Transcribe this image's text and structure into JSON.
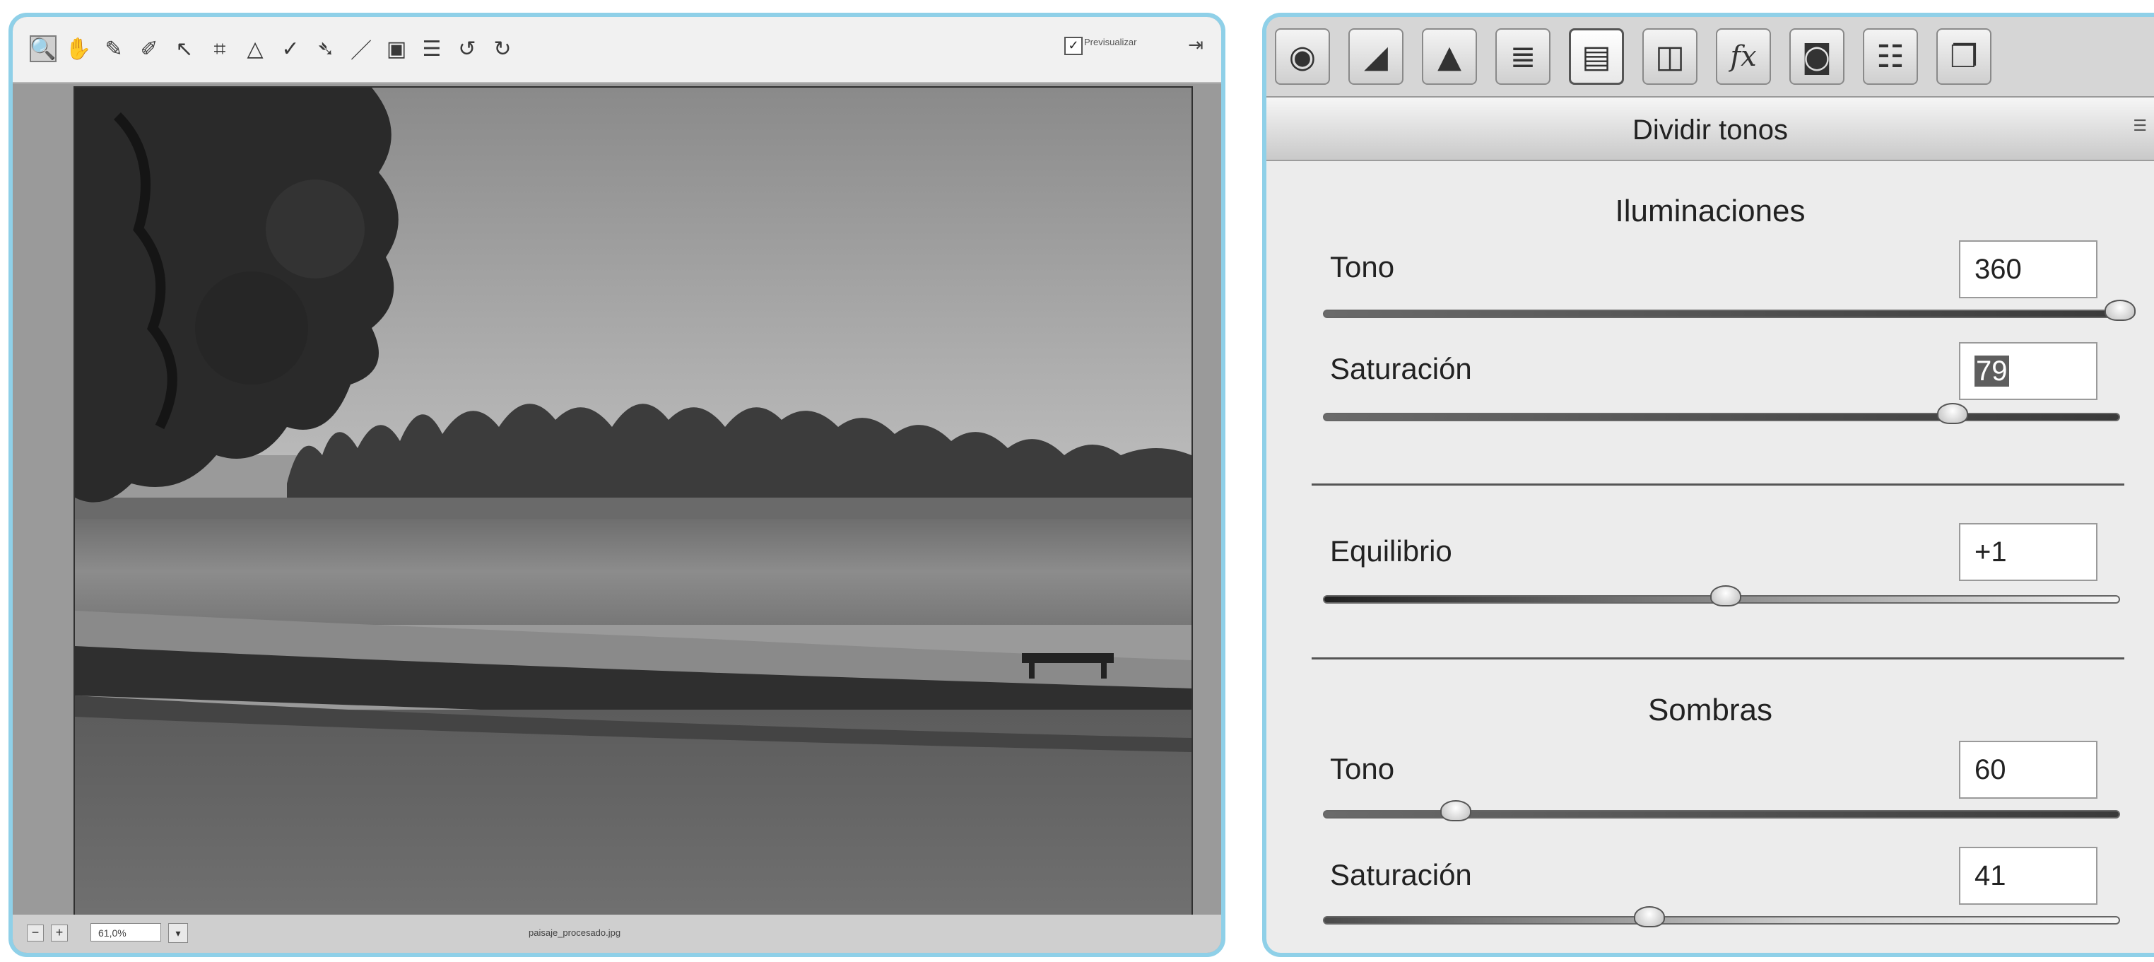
{
  "left_window": {
    "toolbar": {
      "tools": [
        {
          "name": "zoom-tool-icon",
          "glyph": "🔍"
        },
        {
          "name": "hand-tool-icon",
          "glyph": "✋"
        },
        {
          "name": "white-balance-tool-icon",
          "glyph": "✎"
        },
        {
          "name": "color-sampler-tool-icon",
          "glyph": "✐"
        },
        {
          "name": "targeted-adjustment-tool-icon",
          "glyph": "↖"
        },
        {
          "name": "crop-tool-icon",
          "glyph": "⌗"
        },
        {
          "name": "straighten-tool-icon",
          "glyph": "△"
        },
        {
          "name": "spot-removal-tool-icon",
          "glyph": "✓"
        },
        {
          "name": "red-eye-tool-icon",
          "glyph": "➴"
        },
        {
          "name": "adjustment-brush-icon",
          "glyph": "／"
        },
        {
          "name": "graduated-filter-icon",
          "glyph": "▣"
        },
        {
          "name": "preferences-icon",
          "glyph": "☰"
        },
        {
          "name": "rotate-left-icon",
          "glyph": "↺"
        },
        {
          "name": "rotate-right-icon",
          "glyph": "↻"
        }
      ],
      "preview_checked": "✓",
      "preview_label": "Previsualizar",
      "fullscreen_glyph": "⇥"
    },
    "statusbar": {
      "zoom_minus": "−",
      "zoom_plus": "+",
      "zoom_value": "61,0%",
      "zoom_dropdown": "▾",
      "file_name": "paisaje_procesado.jpg"
    }
  },
  "right_panel": {
    "tabs": [
      {
        "name": "tab-basic",
        "glyph": "◉"
      },
      {
        "name": "tab-tone-curve",
        "glyph": "◢"
      },
      {
        "name": "tab-detail",
        "glyph": "▲"
      },
      {
        "name": "tab-hsl",
        "glyph": "≣"
      },
      {
        "name": "tab-split-toning",
        "glyph": "▤"
      },
      {
        "name": "tab-lens-corrections",
        "glyph": "◫"
      },
      {
        "name": "tab-effects",
        "glyph": "fx"
      },
      {
        "name": "tab-camera-calibration",
        "glyph": "◙"
      },
      {
        "name": "tab-presets",
        "glyph": "☷"
      },
      {
        "name": "tab-snapshots",
        "glyph": "❐"
      }
    ],
    "active_tab_index": 4,
    "title": "Dividir tonos",
    "menu_glyph": "☰",
    "highlights": {
      "title": "Iluminaciones",
      "hue": {
        "label": "Tono",
        "value": "360",
        "level": 1.0
      },
      "saturation": {
        "label": "Saturación",
        "value": "79",
        "level": 0.79
      }
    },
    "balance": {
      "label": "Equilibrio",
      "value": "+1",
      "level": 0.505
    },
    "shadows": {
      "title": "Sombras",
      "hue": {
        "label": "Tono",
        "value": "60",
        "level": 0.167
      },
      "saturation": {
        "label": "Saturación",
        "value": "41",
        "level": 0.41
      }
    },
    "colors": {
      "panel_border": "#8fd0e8",
      "slider_fill": "#3a3a3a",
      "slider_light": "#f4f4f4"
    }
  }
}
